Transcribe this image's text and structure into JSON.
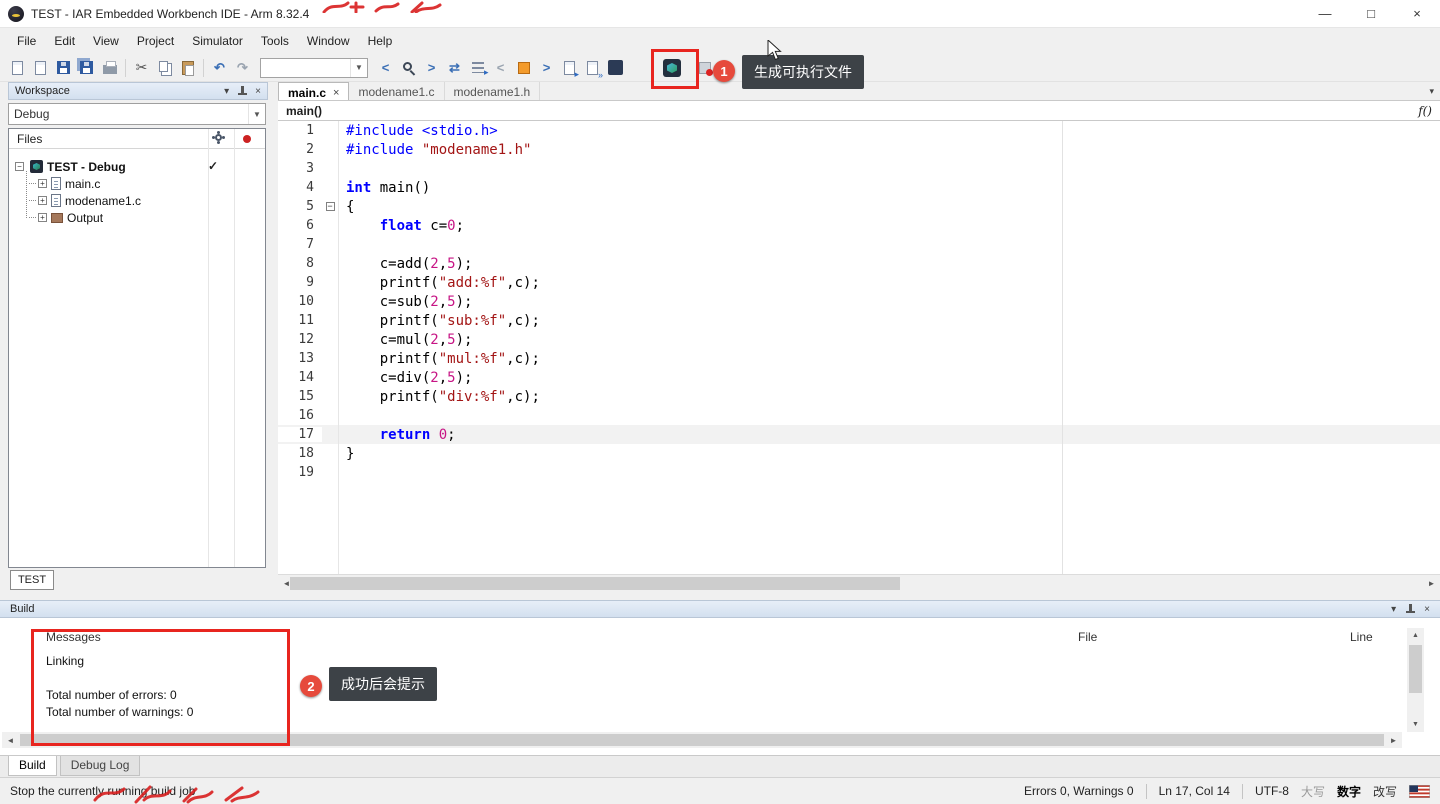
{
  "window": {
    "title": "TEST - IAR Embedded Workbench IDE - Arm 8.32.4"
  },
  "icons": {
    "minimize": "—",
    "maximize": "□",
    "close": "×",
    "dropdown": "▾",
    "combo_arrow": "▼",
    "tab_close": "×",
    "check": "✓",
    "scroll_left": "◄",
    "scroll_right": "►",
    "scroll_up": "▲",
    "scroll_down": "▼",
    "expand_plus": "+",
    "collapse_minus": "−",
    "cut": "✂",
    "undo": "↶",
    "redo": "↷",
    "swap": "⇄",
    "chevron_left": "<",
    "chevron_right": ">",
    "function": "f()"
  },
  "menu": {
    "items": [
      "File",
      "Edit",
      "View",
      "Project",
      "Simulator",
      "Tools",
      "Window",
      "Help"
    ]
  },
  "toolbar": {
    "search_value": "",
    "icon_names": [
      "new-file",
      "open-file",
      "save",
      "save-all",
      "print",
      "cut",
      "copy",
      "paste",
      "undo",
      "redo",
      "search-combo",
      "nav-back",
      "find",
      "nav-forward",
      "find-replace",
      "goto",
      "prev-bookmark",
      "toggle-bookmark",
      "next-bookmark",
      "compile",
      "compile-multiple",
      "project-node",
      "make",
      "stop-build"
    ]
  },
  "workspace": {
    "title": "Workspace",
    "config": "Debug",
    "files_header": "Files",
    "root": "TEST - Debug",
    "children": [
      "main.c",
      "modename1.c",
      "Output"
    ],
    "bottom_tab": "TEST"
  },
  "editor": {
    "tabs": [
      {
        "label": "main.c",
        "active": true
      },
      {
        "label": "modename1.c",
        "active": false
      },
      {
        "label": "modename1.h",
        "active": false
      }
    ],
    "breadcrumb": "main()",
    "lines": [
      {
        "n": "1",
        "seg": [
          [
            "pp",
            "#include <stdio.h>"
          ]
        ]
      },
      {
        "n": "2",
        "seg": [
          [
            "pp",
            "#include "
          ],
          [
            "str",
            "\"modename1.h\""
          ]
        ]
      },
      {
        "n": "3",
        "seg": []
      },
      {
        "n": "4",
        "seg": [
          [
            "kw",
            "int"
          ],
          [
            "pl",
            " main()"
          ]
        ]
      },
      {
        "n": "5",
        "fold": true,
        "seg": [
          [
            "pl",
            "{"
          ]
        ]
      },
      {
        "n": "6",
        "seg": [
          [
            "pl",
            "    "
          ],
          [
            "kw",
            "float"
          ],
          [
            "pl",
            " c="
          ],
          [
            "num",
            "0"
          ],
          [
            "pl",
            ";"
          ]
        ]
      },
      {
        "n": "7",
        "seg": []
      },
      {
        "n": "8",
        "seg": [
          [
            "pl",
            "    c=add("
          ],
          [
            "num",
            "2"
          ],
          [
            "pl",
            ","
          ],
          [
            "num",
            "5"
          ],
          [
            "pl",
            ");"
          ]
        ]
      },
      {
        "n": "9",
        "seg": [
          [
            "pl",
            "    printf("
          ],
          [
            "str",
            "\"add:%f\""
          ],
          [
            "pl",
            ",c);"
          ]
        ]
      },
      {
        "n": "10",
        "seg": [
          [
            "pl",
            "    c=sub("
          ],
          [
            "num",
            "2"
          ],
          [
            "pl",
            ","
          ],
          [
            "num",
            "5"
          ],
          [
            "pl",
            ");"
          ]
        ]
      },
      {
        "n": "11",
        "seg": [
          [
            "pl",
            "    printf("
          ],
          [
            "str",
            "\"sub:%f\""
          ],
          [
            "pl",
            ",c);"
          ]
        ]
      },
      {
        "n": "12",
        "seg": [
          [
            "pl",
            "    c=mul("
          ],
          [
            "num",
            "2"
          ],
          [
            "pl",
            ","
          ],
          [
            "num",
            "5"
          ],
          [
            "pl",
            ");"
          ]
        ]
      },
      {
        "n": "13",
        "seg": [
          [
            "pl",
            "    printf("
          ],
          [
            "str",
            "\"mul:%f\""
          ],
          [
            "pl",
            ",c);"
          ]
        ]
      },
      {
        "n": "14",
        "seg": [
          [
            "pl",
            "    c=div("
          ],
          [
            "num",
            "2"
          ],
          [
            "pl",
            ","
          ],
          [
            "num",
            "5"
          ],
          [
            "pl",
            ");"
          ]
        ]
      },
      {
        "n": "15",
        "seg": [
          [
            "pl",
            "    printf("
          ],
          [
            "str",
            "\"div:%f\""
          ],
          [
            "pl",
            ",c);"
          ]
        ]
      },
      {
        "n": "16",
        "seg": []
      },
      {
        "n": "17",
        "hl": true,
        "seg": [
          [
            "pl",
            "    "
          ],
          [
            "kw",
            "return"
          ],
          [
            "pl",
            " "
          ],
          [
            "num",
            "0"
          ],
          [
            "pl",
            ";"
          ]
        ]
      },
      {
        "n": "18",
        "seg": [
          [
            "pl",
            "}"
          ]
        ]
      },
      {
        "n": "19",
        "seg": []
      }
    ]
  },
  "build": {
    "title": "Build",
    "columns": {
      "messages": "Messages",
      "file": "File",
      "line": "Line"
    },
    "rows": [
      "Linking",
      "Total number of errors: 0",
      "Total number of warnings: 0"
    ],
    "tabs": [
      {
        "label": "Build",
        "active": true
      },
      {
        "label": "Debug Log",
        "active": false
      }
    ]
  },
  "statusbar": {
    "left": "Stop the currently running build job",
    "errors": "Errors 0, Warnings 0",
    "caret": "Ln 17, Col 14",
    "encoding": "UTF-8",
    "ime_caps": "大写",
    "ime_num": "数字",
    "ime_ovr": "改写"
  },
  "annotations": {
    "step1_number": "1",
    "step1_tooltip": "生成可执行文件",
    "step2_number": "2",
    "step2_tooltip": "成功后会提示"
  },
  "colors": {
    "annotation_red": "#e8251f",
    "tooltip_bg": "#3d4247",
    "keyword": "#0000ff",
    "preprocessor": "#0000ff",
    "string": "#a31515",
    "number": "#c71585",
    "panel_header_blue": "#dbe5f1"
  }
}
